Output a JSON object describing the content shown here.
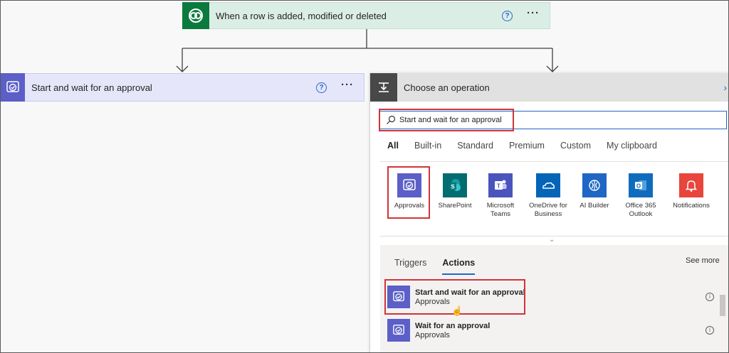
{
  "trigger": {
    "title": "When a row is added, modified or deleted",
    "help": "?",
    "more": "···",
    "color": "#0b7a3e"
  },
  "branch_left": {
    "title": "Start and wait for an approval",
    "help": "?",
    "more": "···",
    "color": "#5b5fc7"
  },
  "operation_panel": {
    "title": "Choose an operation",
    "search_value": "Start and wait for an approval",
    "tabs": [
      "All",
      "Built-in",
      "Standard",
      "Premium",
      "Custom",
      "My clipboard"
    ],
    "active_tab": "All",
    "connectors": [
      {
        "label": "Approvals",
        "icon": "approvals-icon",
        "color": "#5b5fc7"
      },
      {
        "label": "SharePoint",
        "icon": "sharepoint-icon",
        "color": "#036c70"
      },
      {
        "label": "Microsoft Teams",
        "icon": "teams-icon",
        "color": "#4b53bc"
      },
      {
        "label": "OneDrive for Business",
        "icon": "onedrive-icon",
        "color": "#0364b8"
      },
      {
        "label": "AI Builder",
        "icon": "ai-builder-icon",
        "color": "#1f66c5"
      },
      {
        "label": "Office 365 Outlook",
        "icon": "outlook-icon",
        "color": "#0f6cbd"
      },
      {
        "label": "Notifications",
        "icon": "bell-icon",
        "color": "#e8453c"
      }
    ],
    "sub_tabs": [
      "Triggers",
      "Actions"
    ],
    "active_sub_tab": "Actions",
    "see_more": "See more",
    "actions": [
      {
        "title": "Start and wait for an approval",
        "connector": "Approvals"
      },
      {
        "title": "Wait for an approval",
        "connector": "Approvals"
      }
    ]
  }
}
